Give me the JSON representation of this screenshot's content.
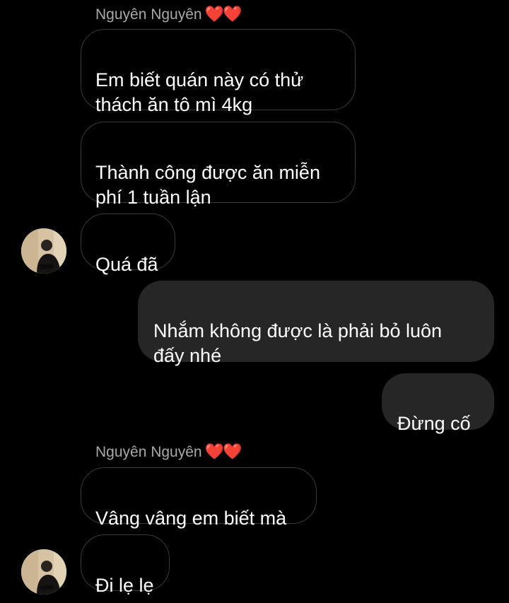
{
  "theme": {
    "background": "#000000",
    "incoming_border": "#3a3a3a",
    "outgoing_bubble": "#262626",
    "sender_name_color": "#a8a8a8",
    "heart_color": "#e0242c"
  },
  "conversation": {
    "groups": [
      {
        "sender": "Nguyên Nguyên",
        "sender_emoji": "❤️❤️",
        "messages": [
          "Em biết quán này có thử\nthách ăn tô mì 4kg",
          "Thành công được ăn miễn\nphí 1 tuần lận",
          "Quá đã"
        ],
        "avatar_icon": "profile-photo-avatar"
      },
      {
        "sender": "me",
        "messages": [
          "Nhắm không được là phải bỏ luôn\nđấy nhé",
          "Đừng cố"
        ]
      },
      {
        "sender": "Nguyên Nguyên",
        "sender_emoji": "❤️❤️",
        "messages": [
          "Vâng vâng em biết mà",
          "Đi lẹ lẹ"
        ],
        "avatar_icon": "profile-photo-avatar"
      }
    ]
  }
}
